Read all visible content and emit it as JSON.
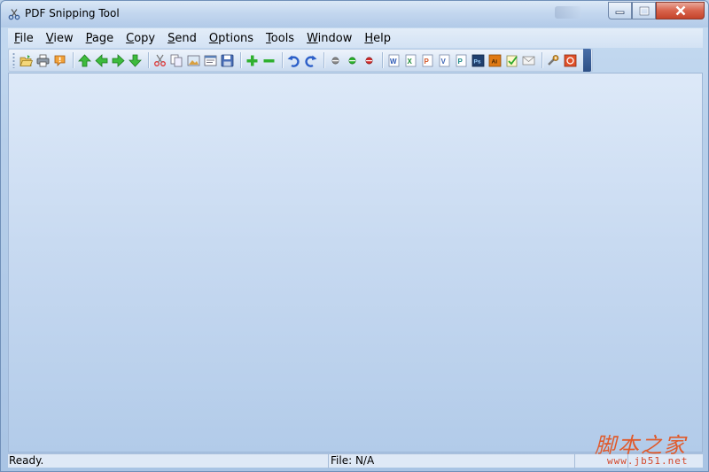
{
  "window": {
    "title": "PDF Snipping Tool"
  },
  "menu": {
    "items": [
      "File",
      "View",
      "Page",
      "Copy",
      "Send",
      "Options",
      "Tools",
      "Window",
      "Help"
    ]
  },
  "toolbar": {
    "groups": [
      [
        "open-icon",
        "print-icon",
        "info-icon"
      ],
      [
        "arrow-up-icon",
        "arrow-left-icon",
        "arrow-right-icon",
        "arrow-down-icon"
      ],
      [
        "scissors-icon",
        "copy-icon",
        "image-icon",
        "text-icon",
        "save-icon"
      ],
      [
        "zoom-in-icon",
        "zoom-out-icon"
      ],
      [
        "undo-icon",
        "redo-icon"
      ],
      [
        "dot-gray-icon",
        "dot-green-icon",
        "dot-red-icon"
      ],
      [
        "word-icon",
        "excel-icon",
        "powerpoint-icon",
        "visio-icon",
        "publisher-icon",
        "photoshop-icon",
        "illustrator-icon",
        "notepad-icon",
        "mail-icon"
      ],
      [
        "settings-icon",
        "stop-icon"
      ]
    ]
  },
  "status": {
    "ready": "Ready.",
    "file": "File: N/A"
  },
  "watermark": {
    "text_cn": "脚本之家",
    "url": "www.jb51.net"
  }
}
